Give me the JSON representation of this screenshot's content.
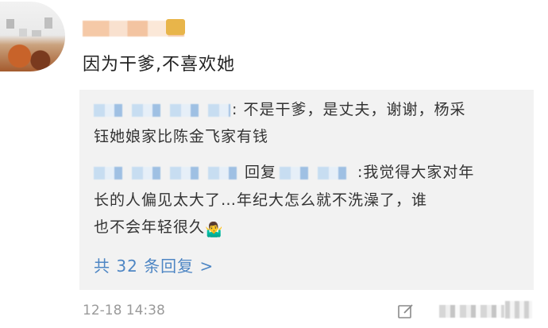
{
  "comment": {
    "text": "因为干爹,不喜欢她",
    "timestamp": "12-18 14:38"
  },
  "replies": {
    "reply1_line1": ": 不是干爹，是丈夫，谢谢，杨采",
    "reply1_line2": "钰她娘家比陈金飞家有钱",
    "reply2_reply_word": "回复",
    "reply2_line1": ":我觉得大家对年",
    "reply2_line2": "长的人偏见太大了…年纪大怎么就不洗澡了，谁",
    "reply2_line3": "也不会年轻很久",
    "reply2_emoji": "🤷‍♂️",
    "more_label": "共 32 条回复 >"
  },
  "icons": {
    "edit": "edit-icon",
    "emoji": "shrug-emoji"
  },
  "colors": {
    "link": "#4e86c4",
    "panel_bg": "#f2f2f2",
    "timestamp": "#9a9a9a"
  }
}
